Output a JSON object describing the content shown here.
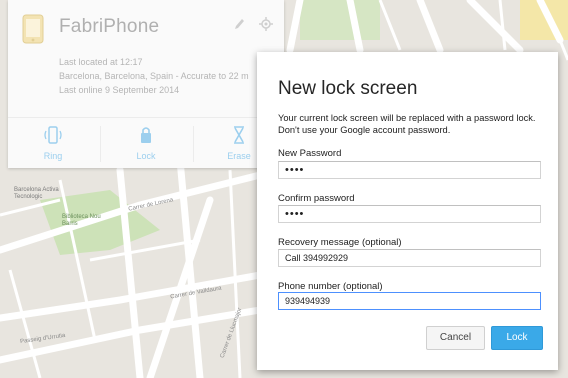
{
  "device": {
    "name": "FabriPhone",
    "last_located": "Last located at 12:17",
    "location": "Barcelona, Barcelona, Spain - Accurate to 22 m",
    "last_online": "Last online 9 September 2014",
    "actions": [
      {
        "label": "Ring",
        "icon": "ring-phone-icon"
      },
      {
        "label": "Lock",
        "icon": "lock-icon"
      },
      {
        "label": "Erase",
        "icon": "erase-icon"
      }
    ],
    "accent_color": "#9ccfee"
  },
  "map_labels": {
    "biblioteca": "Biblioteca Nou Barris",
    "centro": "Barcelona Activa Tecnologic",
    "lorena": "Carrer de Lorena",
    "passeig": "Passeig d'Urrutia",
    "valldaura": "Carrer de Valldaura",
    "llucmajor": "Carrer de Llucmajor"
  },
  "dialog": {
    "title": "New lock screen",
    "description": "Your current lock screen will be replaced with a password lock. Don't use your Google account password.",
    "new_password_label": "New Password",
    "new_password_value": "••••",
    "confirm_password_label": "Confirm password",
    "confirm_password_value": "••••",
    "recovery_label": "Recovery message (optional)",
    "recovery_value": "Call 394992929",
    "phone_label": "Phone number (optional)",
    "phone_value": "939494939",
    "cancel_label": "Cancel",
    "lock_label": "Lock",
    "lock_color": "#3aa9e8"
  }
}
